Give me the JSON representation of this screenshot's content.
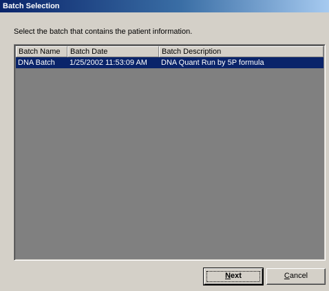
{
  "window": {
    "title": "Batch Selection"
  },
  "instruction": "Select the batch that contains the patient information.",
  "table": {
    "columns": [
      "Batch Name",
      "Batch Date",
      "Batch Description"
    ],
    "rows": [
      {
        "selected": true,
        "cells": [
          "DNA Batch",
          "1/25/2002 11:53:09 AM",
          "DNA Quant Run by 5P formula"
        ]
      }
    ]
  },
  "buttons": {
    "next": {
      "mnemonic": "N",
      "rest": "ext",
      "label": "Next"
    },
    "cancel": {
      "mnemonic": "C",
      "rest": "ancel",
      "label": "Cancel"
    }
  },
  "colors": {
    "selection": "#0a246a",
    "list_background": "#808080",
    "face": "#d4d0c8"
  }
}
